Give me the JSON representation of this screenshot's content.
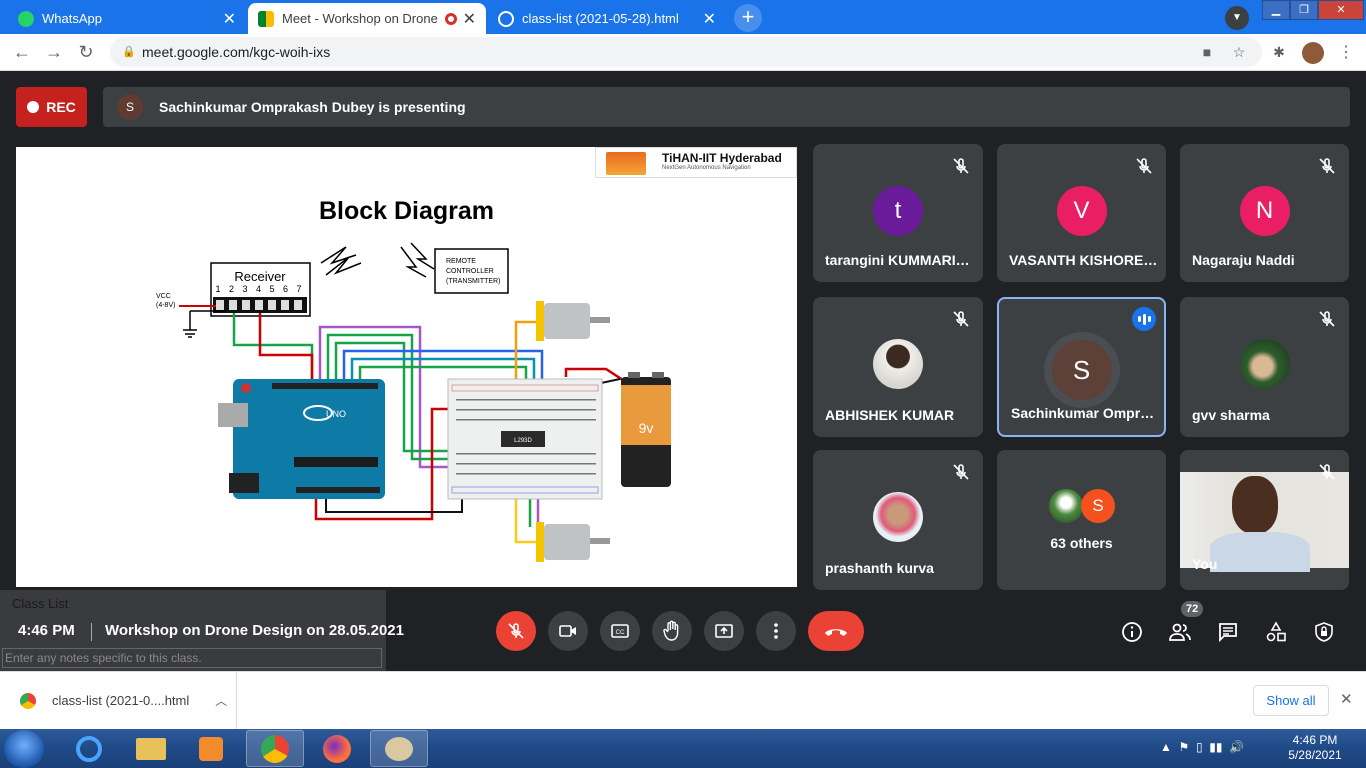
{
  "browser": {
    "tabs": [
      {
        "title": "WhatsApp",
        "favicon": "whatsapp-icon"
      },
      {
        "title": "Meet - Workshop on Drone",
        "favicon": "meet-icon",
        "recording_indicator": true
      },
      {
        "title": "class-list (2021-05-28).html",
        "favicon": "globe-icon"
      }
    ],
    "url": "meet.google.com/kgc-woih-ixs"
  },
  "meet": {
    "rec_label": "REC",
    "presenter_initial": "S",
    "presenting_text": "Sachinkumar Omprakash Dubey is presenting",
    "slide": {
      "title": "Block Diagram",
      "logo_title": "TiHAN-IIT Hyderabad",
      "logo_subtitle": "NextGen Autonomous Navigation",
      "receiver_label": "Receiver",
      "receiver_pins": "1 2 3 4 5 6 7",
      "vcc_label": "VCC",
      "vcc_range": "(4-8V)",
      "remote_line1": "REMOTE",
      "remote_line2": "CONTROLLER",
      "remote_line3": "(TRANSMITTER)",
      "chip_label": "L293D",
      "battery_label": "9v",
      "arduino_label": "UNO"
    },
    "participants": [
      {
        "name": "tarangini KUMMARIK...",
        "initial": "t",
        "color": "#6a1b9a",
        "muted": true
      },
      {
        "name": "VASANTH KISHORE ...",
        "initial": "V",
        "color": "#e91e63",
        "muted": true
      },
      {
        "name": "Nagaraju Naddi",
        "initial": "N",
        "color": "#e91e63",
        "muted": true
      },
      {
        "name": "ABHISHEK KUMAR",
        "photo": true,
        "muted": true
      },
      {
        "name": "Sachinkumar Ompra...",
        "initial": "S",
        "color": "#5d4037",
        "speaking": true
      },
      {
        "name": "gvv sharma",
        "photo": true,
        "muted": true
      },
      {
        "name": "prashanth kurva",
        "photo": true,
        "muted": true
      },
      {
        "name": "63 others",
        "initial": "S",
        "color": "#f4511e"
      },
      {
        "name": "You",
        "video": true,
        "muted": true
      }
    ],
    "bottom": {
      "time": "4:46 PM",
      "meeting_title": "Workshop on Drone Design on 28.05.2021",
      "people_count": "72"
    }
  },
  "class_list_overlay": {
    "title": "Class List",
    "notes_placeholder": "Enter any notes specific to this class."
  },
  "download_bar": {
    "file": "class-list (2021-0....html",
    "show_all": "Show all"
  },
  "taskbar": {
    "time": "4:46 PM",
    "date": "5/28/2021"
  }
}
